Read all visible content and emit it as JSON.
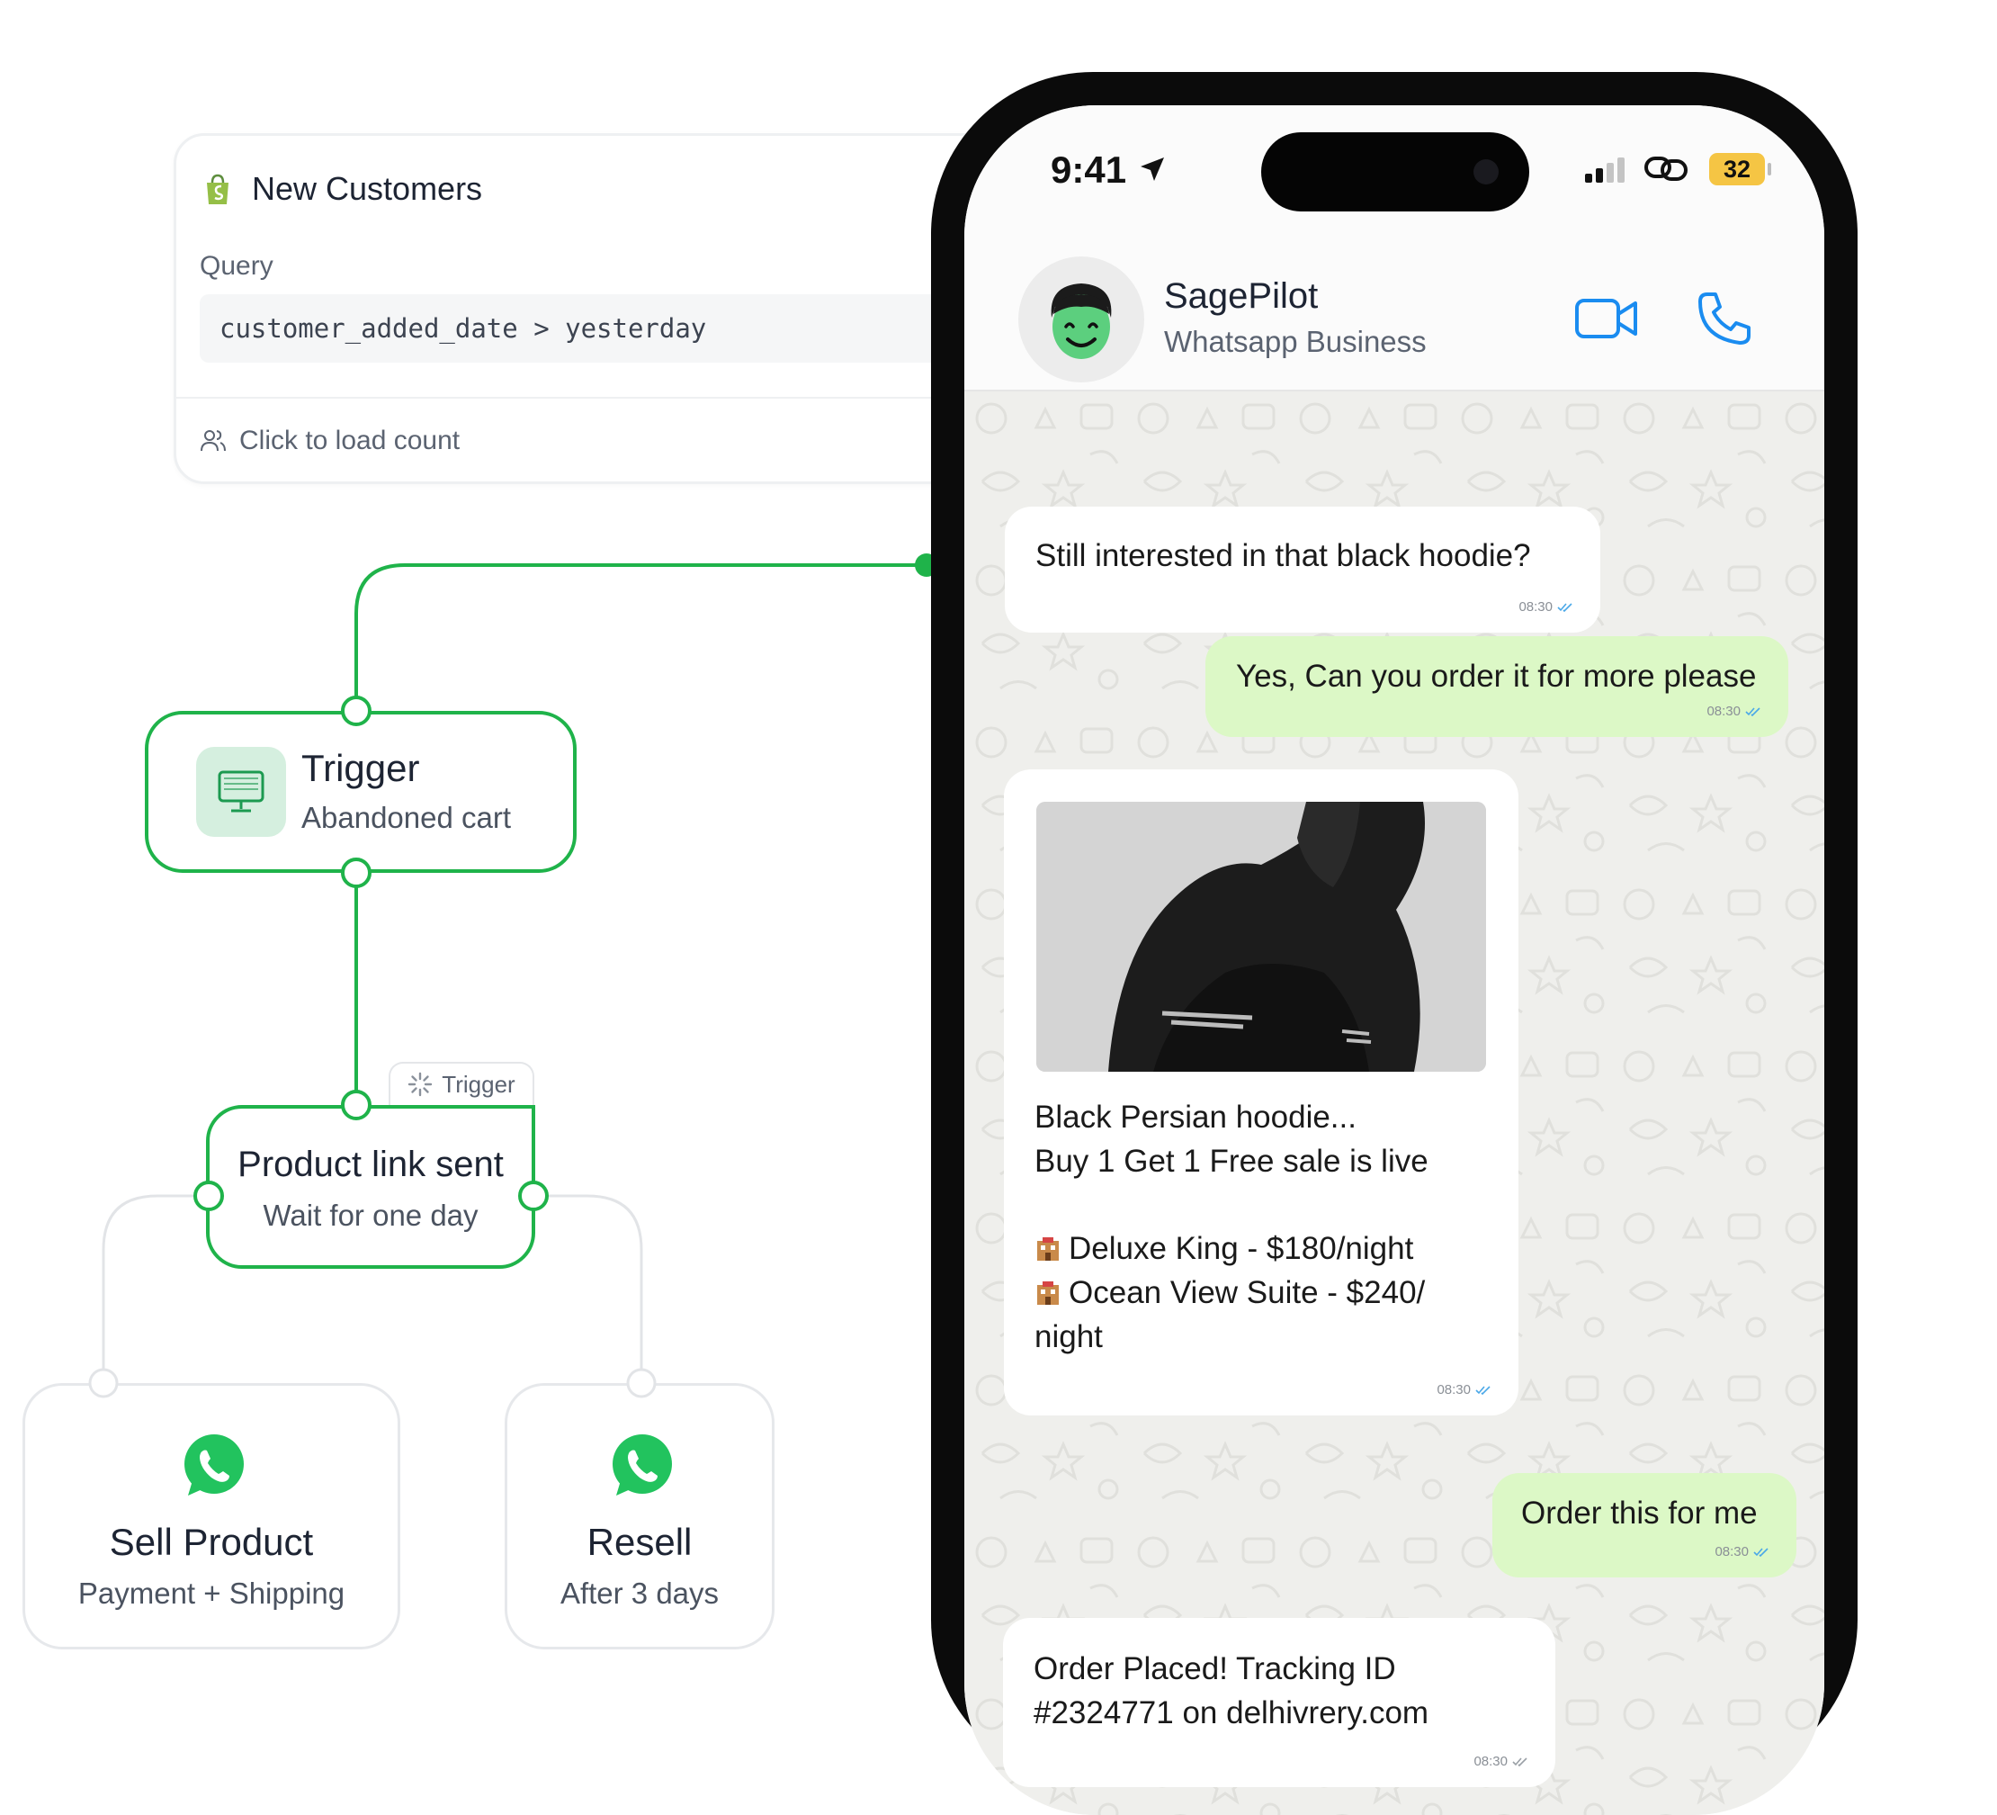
{
  "query_card": {
    "title": "New Customers",
    "query_label": "Query",
    "query_value": "customer_added_date > yesterday",
    "load_count_label": "Click to load count"
  },
  "flow": {
    "trigger_node": {
      "title": "Trigger",
      "subtitle": "Abandoned cart"
    },
    "trigger_tag": "Trigger",
    "product_node": {
      "title": "Product link sent",
      "subtitle": "Wait for one day"
    },
    "sell_node": {
      "title": "Sell Product",
      "subtitle": "Payment + Shipping"
    },
    "resell_node": {
      "title": "Resell",
      "subtitle": "After 3 days"
    }
  },
  "status_bar": {
    "time": "9:41",
    "battery": "32"
  },
  "chat_header": {
    "name": "SagePilot",
    "subtitle": "Whatsapp Business"
  },
  "messages": [
    {
      "direction": "in",
      "text": "Still interested in that black hoodie?",
      "time": "08:30"
    },
    {
      "direction": "out",
      "text": "Yes, Can you order it for more please",
      "time": "08:30"
    },
    {
      "direction": "in",
      "line1": "Black Persian hoodie...",
      "line2": "Buy 1 Get 1 Free sale is live",
      "line3": "Deluxe King - $180/night",
      "line4": "Ocean View Suite - $240/ night",
      "time": "08:30"
    },
    {
      "direction": "out",
      "text": "Order this for me",
      "time": "08:30"
    },
    {
      "direction": "in",
      "line1": "Order Placed! Tracking ID",
      "line2": "#2324771 on delhivrery.com",
      "time": "08:30"
    }
  ],
  "colors": {
    "flow_green": "#1fb34a",
    "outgoing_bubble": "#dcf8c6",
    "accent_blue": "#1a8cf0",
    "battery": "#f5c544"
  }
}
